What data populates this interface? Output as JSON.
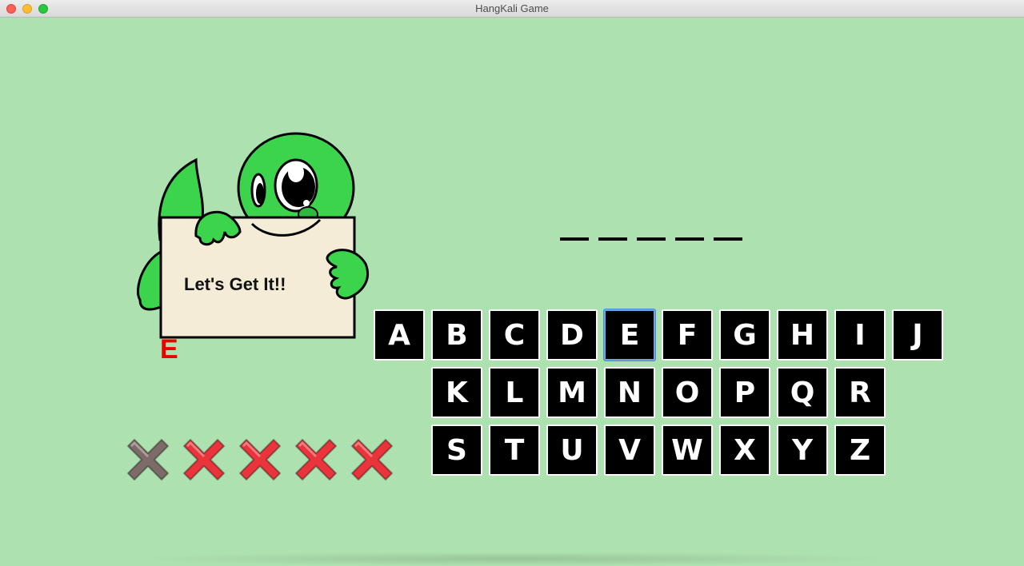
{
  "window": {
    "title": "HangKali Game"
  },
  "sign": {
    "text": "Let's Get It!!"
  },
  "used_letters": "E",
  "word": {
    "slots": [
      "",
      "",
      "",
      "",
      ""
    ]
  },
  "keyboard": {
    "rows": [
      [
        "A",
        "B",
        "C",
        "D",
        "E",
        "F",
        "G",
        "H",
        "I",
        "J"
      ],
      [
        "K",
        "L",
        "M",
        "N",
        "O",
        "P",
        "Q",
        "R"
      ],
      [
        "S",
        "T",
        "U",
        "V",
        "W",
        "X",
        "Y",
        "Z"
      ]
    ],
    "focused_key": "E"
  },
  "strikes": {
    "total": 5,
    "used": 1,
    "used_color": "#7d6b67",
    "remaining_color": "#e8343a"
  },
  "colors": {
    "background": "#ade1b0",
    "key_bg": "#000000",
    "key_text": "#ffffff",
    "mascot_green": "#3dd44d",
    "used_letter": "#ee0000"
  }
}
